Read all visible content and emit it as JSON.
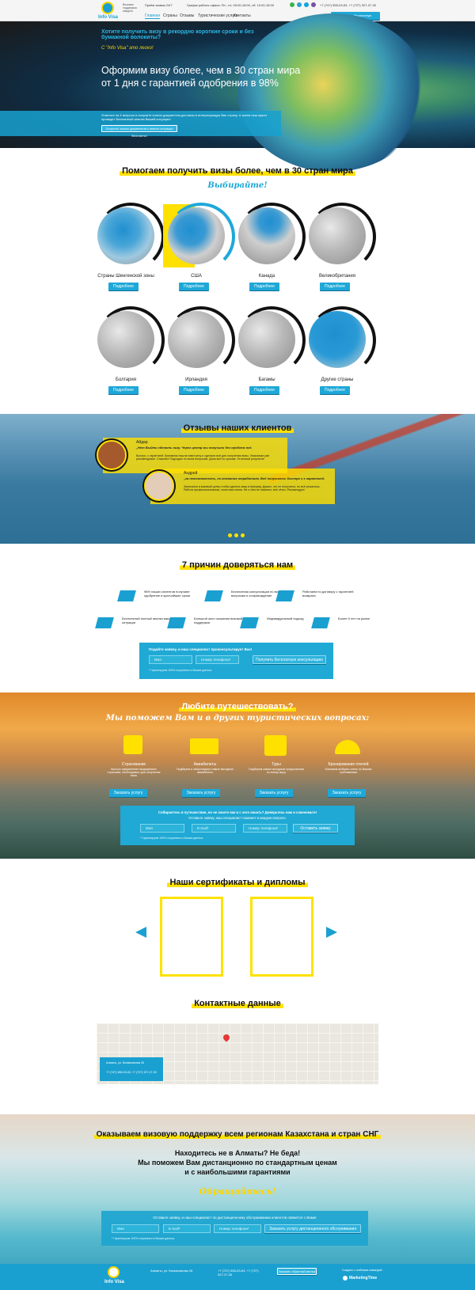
{
  "header": {
    "logo_text": "Info Visa",
    "tagline": "Визовая поддержка каждого",
    "hours": "Приём заявок 24/7",
    "office_hours": "График работы офиса: Пн - пт: 09:00-18:00, сб: 10:00-15:00",
    "phones": "+7 (747) 555-03-63, +7 (727) 327-27-30",
    "cta_label": "Получить бесплатную консультацию",
    "nav": [
      "Главная",
      "Страны",
      "Отзывы",
      "Туристические услуги",
      "Контакты"
    ]
  },
  "hero": {
    "question": "Хотите получить визу в рекордно короткие сроки и без бумажной волокиты?",
    "slogan": "С \"Info Visa\" это легко!",
    "headline_1": "Оформим визу более, чем в 30 стран мира",
    "headline_2": "от 1 дня с гарантией одобрения в 98%",
    "form_text": "Ответьте на 4 вопроса и получите список документов для визы в интересующую Вас страну. А затем наш юрист проведет бесплатный анализ Вашей ситуации!",
    "form_button": "Получить список документов и анализ ситуации бесплатно!"
  },
  "countries": {
    "title": "Помогаем получить визы более, чем в 30 стран мира",
    "subtitle": "Выбирайте!",
    "more_label": "Подробнее",
    "items": [
      {
        "name": "Страны Шенгенской зоны"
      },
      {
        "name": "США"
      },
      {
        "name": "Канада"
      },
      {
        "name": "Великобритания"
      },
      {
        "name": "Болгария"
      },
      {
        "name": "Ирландия"
      },
      {
        "name": "Багамы"
      },
      {
        "name": "Другие страны"
      }
    ]
  },
  "reviews": {
    "title": "Отзывы наших клиентов",
    "items": [
      {
        "name": "Айдар",
        "quote": "„Нет Выйти сделать визу. Через центр мы получили без проблем всё.",
        "text": "Быстро, с гарантией. Компания пошла навстречу и сделали всё для получения визы. Знакомым уже рекомендовал. Спасибо! Подходил по всем вопросам. Дали всё по срокам. Отличный результат!"
      },
      {
        "name": "Андрей",
        "quote": "„за невозможность, но компания отработала. Всё получилось быстро и с гарантией.",
        "text": "Записался в визовый центр чтобы сделать визу в Америку. Думал, что не получится, но всё решилось. Работа профессиональная, понятная схема. Ни о чём не пожалел, всё чётко. Рекомендую!"
      }
    ]
  },
  "reasons": {
    "title": "7 причин доверяться нам",
    "items": [
      "98% наших клиентов получают одобрение в кратчайшие сроки",
      "Бесплатная консультация по всем вопросам и сопровождение",
      "Работаем по договору с гарантией возврата",
      "Бесплатный полный анализ вашей ситуации",
      "Большой опыт оказания визовой поддержки",
      "Индивидуальный подход",
      "Более 5 лет на рынке"
    ],
    "form_title": "Подайте заявку, и наш специалист проконсультирует Вас!",
    "name_placeholder": "Имя",
    "phone_placeholder": "Номер телефона*",
    "button": "Получить бесплатную консультацию",
    "note": "* Гарантируем 100% сохранность Ваших данных"
  },
  "travel": {
    "title": "Любите путешествовать?",
    "subtitle": "Мы поможем Вам и в других туристических вопросах:",
    "services": [
      {
        "name": "Страхование",
        "desc": "Быстро оформление медицинских страховок, необходимых для получения визы",
        "button": "Заказать услугу"
      },
      {
        "name": "Авиабилеты",
        "desc": "Подберем и забронируем самые выгодные авиабилеты",
        "button": "Заказать услугу"
      },
      {
        "name": "Туры",
        "desc": "Подберем самые выгодные предложения по всему миру",
        "button": "Заказать услугу"
      },
      {
        "name": "Бронирование отелей",
        "desc": "Поможем выбрать отель по Вашим требованиям",
        "button": "Заказать услугу"
      }
    ],
    "form_title": "Собираетесь в путешествие, но не знаете как и с чего начать? Доверьтесь нам и сэкономьте!",
    "form_sub": "Оставьте заявку, наш специалист поможет в каждом вопросе.",
    "name_placeholder": "Имя",
    "email_placeholder": "E-mail*",
    "phone_placeholder": "Номер телефона*",
    "button": "Оставить заявку",
    "note": "* Гарантируем 100% сохранность Ваших данных"
  },
  "certificates": {
    "title": "Наши сертификаты и дипломы"
  },
  "contacts": {
    "title": "Контактные данные",
    "address": "Алматы, ул. Бекмаханова 26",
    "phones": "+7 (747) 555-03-63, +7 (727) 327-27-30"
  },
  "remote": {
    "title": "Оказываем визовую поддержку всем регионам Казахстана и стран СНГ",
    "line1": "Находитесь не в Алматы? Не беда!",
    "line2": "Мы поможем Вам дистанционно по стандартным ценам",
    "line3": "и с наибольшими гарантиями",
    "cta": "Обращайтесь!",
    "form_title": "Оставьте заявку, и наш специалист по дистанционному обслуживанию клиентов свяжется с Вами!",
    "name_placeholder": "Имя",
    "email_placeholder": "E-mail*",
    "phone_placeholder": "Номер телефона*",
    "button": "Заказать услугу дистанционного обслуживания",
    "note": "* Гарантируем 100% сохранность Ваших данных"
  },
  "footer": {
    "logo_text": "Info Visa",
    "address": "Алматы, ул. Бекмаханова 26",
    "phones": "+7 (747) 555-03-63, +7 (727) 327-27-30",
    "button": "Заказать обратный звонок",
    "credit": "Создано с любовью командой",
    "brand": "MarketingTime"
  }
}
